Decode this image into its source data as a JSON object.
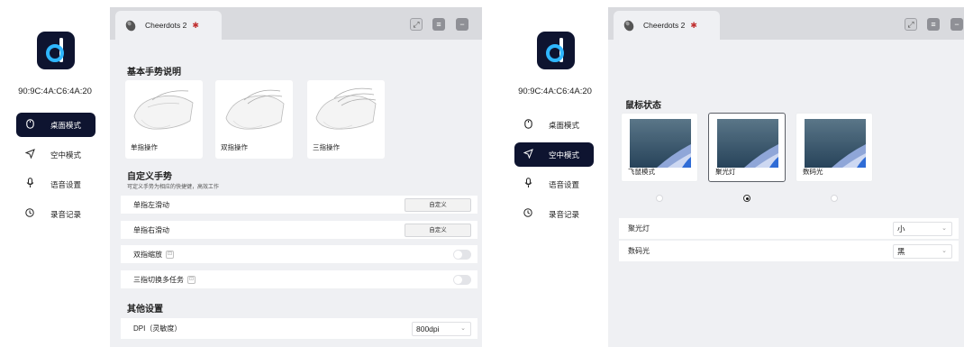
{
  "left": {
    "sidebar": {
      "mac": "90:9C:4A:C6:4A:20",
      "items": [
        {
          "label": "桌面模式",
          "icon": "mouse-icon",
          "active": true
        },
        {
          "label": "空中模式",
          "icon": "send-icon",
          "active": false
        },
        {
          "label": "语音设置",
          "icon": "microphone-icon",
          "active": false
        },
        {
          "label": "录音记录",
          "icon": "clock-icon",
          "active": false
        }
      ]
    },
    "tab": {
      "title": "Cheerdots 2"
    },
    "basic": {
      "title": "基本手势说明",
      "cards": [
        {
          "label": "单指操作"
        },
        {
          "label": "双指操作"
        },
        {
          "label": "三指操作"
        }
      ]
    },
    "custom": {
      "title": "自定义手势",
      "subtitle": "可定义手势为相应的快捷键，高效工作",
      "rows": [
        {
          "label": "单指左滑动",
          "button": "自定义"
        },
        {
          "label": "单指右滑动",
          "button": "自定义"
        },
        {
          "label": "双指缩放"
        },
        {
          "label": "三指切换多任务"
        }
      ]
    },
    "other": {
      "title": "其他设置",
      "dpi_label": "DPI（灵敏度）",
      "dpi_value": "800dpi"
    }
  },
  "right": {
    "sidebar": {
      "mac": "90:9C:4A:C6:4A:20",
      "items": [
        {
          "label": "桌面模式",
          "icon": "mouse-icon",
          "active": false
        },
        {
          "label": "空中模式",
          "icon": "send-icon",
          "active": true
        },
        {
          "label": "语音设置",
          "icon": "microphone-icon",
          "active": false
        },
        {
          "label": "录音记录",
          "icon": "clock-icon",
          "active": false
        }
      ]
    },
    "tab": {
      "title": "Cheerdots 2"
    },
    "status": {
      "title": "鼠标状态",
      "modes": [
        {
          "label": "飞鼠模式",
          "selected": false
        },
        {
          "label": "聚光灯",
          "selected": true
        },
        {
          "label": "数码光",
          "selected": false
        }
      ]
    },
    "settings": [
      {
        "label": "聚光灯",
        "value": "小"
      },
      {
        "label": "数码光",
        "value": "黑"
      }
    ]
  },
  "colors": {
    "accent": "#0e1430",
    "panel": "#eff0f3",
    "tabbar": "#d9dade",
    "logo_blue": "#2fb6ff"
  }
}
